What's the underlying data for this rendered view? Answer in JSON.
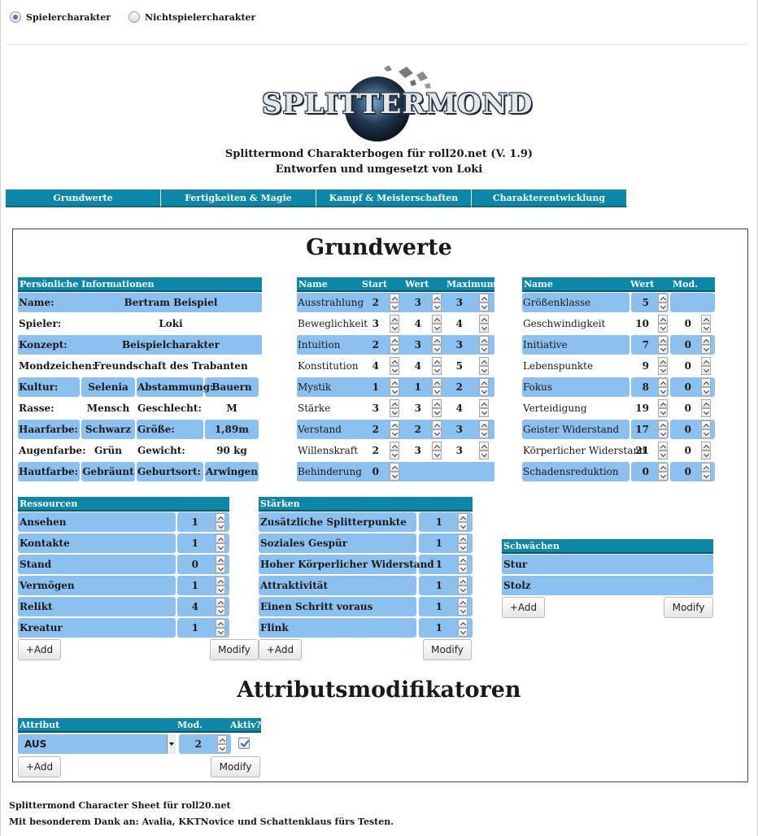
{
  "radio": {
    "pc": "Spielercharakter",
    "npc": "Nichtspielercharakter"
  },
  "logo": {
    "text": "SPLITTERMOND"
  },
  "subtitle": {
    "line1": "Splittermond Charakterbogen für roll20.net (V. 1.9)",
    "line2": "Entworfen und umgesetzt von Loki"
  },
  "tabs": [
    "Grundwerte",
    "Fertigkeiten & Magie",
    "Kampf & Meisterschaften",
    "Charakterentwicklung"
  ],
  "title": "Grundwerte",
  "personal": {
    "header": "Persönliche Informationen",
    "name_label": "Name:",
    "name": "Bertram Beispiel",
    "player_label": "Spieler:",
    "player": "Loki",
    "concept_label": "Konzept:",
    "concept": "Beispielcharakter",
    "moon_label": "Mondzeichen:",
    "moon": "Freundschaft des Trabanten",
    "culture_label": "Kultur:",
    "culture": "Selenia",
    "descent_label": "Abstammung:",
    "descent": "Bauern",
    "race_label": "Rasse:",
    "race": "Mensch",
    "gender_label": "Geschlecht:",
    "gender": "M",
    "hair_label": "Haarfarbe:",
    "hair": "Schwarz",
    "height_label": "Größe:",
    "height": "1,89m",
    "eyes_label": "Augenfarbe:",
    "eyes": "Grün",
    "weight_label": "Gewicht:",
    "weight": "90 kg",
    "skin_label": "Hautfarbe:",
    "skin": "Gebräunt",
    "birthplace_label": "Geburtsort:",
    "birthplace": "Arwingen"
  },
  "attributes": {
    "headers": {
      "name": "Name",
      "start": "Start",
      "value": "Wert",
      "max": "Maximum"
    },
    "rows": [
      {
        "name": "Ausstrahlung",
        "start": "2",
        "value": "3",
        "max": "3"
      },
      {
        "name": "Beweglichkeit",
        "start": "3",
        "value": "4",
        "max": "4"
      },
      {
        "name": "Intuition",
        "start": "2",
        "value": "3",
        "max": "3"
      },
      {
        "name": "Konstitution",
        "start": "4",
        "value": "4",
        "max": "5"
      },
      {
        "name": "Mystik",
        "start": "1",
        "value": "1",
        "max": "2"
      },
      {
        "name": "Stärke",
        "start": "3",
        "value": "3",
        "max": "4"
      },
      {
        "name": "Verstand",
        "start": "2",
        "value": "2",
        "max": "3"
      },
      {
        "name": "Willenskraft",
        "start": "2",
        "value": "3",
        "max": "3"
      }
    ],
    "burden_label": "Behinderung",
    "burden": "0"
  },
  "derived": {
    "headers": {
      "name": "Name",
      "value": "Wert",
      "mod": "Mod."
    },
    "rows": [
      {
        "name": "Größenklasse",
        "value": "5",
        "mod": ""
      },
      {
        "name": "Geschwindigkeit",
        "value": "10",
        "mod": "0"
      },
      {
        "name": "Initiative",
        "value": "7",
        "mod": "0"
      },
      {
        "name": "Lebenspunkte",
        "value": "9",
        "mod": "0"
      },
      {
        "name": "Fokus",
        "value": "8",
        "mod": "0"
      },
      {
        "name": "Verteidigung",
        "value": "19",
        "mod": "0"
      },
      {
        "name": "Geister Widerstand",
        "value": "17",
        "mod": "0"
      },
      {
        "name": "Körperlicher Widerstand",
        "value": "21",
        "mod": "0"
      },
      {
        "name": "Schadensreduktion",
        "value": "0",
        "mod": "0"
      }
    ]
  },
  "resources": {
    "header": "Ressourcen",
    "rows": [
      {
        "name": "Ansehen",
        "value": "1"
      },
      {
        "name": "Kontakte",
        "value": "1"
      },
      {
        "name": "Stand",
        "value": "0"
      },
      {
        "name": "Vermögen",
        "value": "1"
      },
      {
        "name": "Relikt",
        "value": "4"
      },
      {
        "name": "Kreatur",
        "value": "1"
      }
    ]
  },
  "strengths": {
    "header": "Stärken",
    "rows": [
      {
        "name": "Zusätzliche Splitterpunkte",
        "value": "1"
      },
      {
        "name": "Soziales Gespür",
        "value": "1"
      },
      {
        "name": "Hoher Körperlicher Widerstand",
        "value": "1"
      },
      {
        "name": "Attraktivität",
        "value": "1"
      },
      {
        "name": "Einen Schritt voraus",
        "value": "1"
      },
      {
        "name": "Flink",
        "value": "1"
      }
    ]
  },
  "weaknesses": {
    "header": "Schwächen",
    "rows": [
      "Stur",
      "Stolz"
    ]
  },
  "buttons": {
    "add": "+Add",
    "modify": "Modify"
  },
  "attrmod": {
    "title": "Attributsmodifikatoren",
    "headers": {
      "attr": "Attribut",
      "mod": "Mod.",
      "active": "Aktiv?"
    },
    "attribute": "AUS",
    "mod": "2",
    "active": true
  },
  "footer": {
    "line1": "Splittermond Character Sheet für roll20.net",
    "line2": "Mit besonderem Dank an: Avalia, KKTNovice und Schattenklaus fürs Testen."
  },
  "colors": {
    "header": "#0d87a8",
    "field": "#8cc1ef"
  }
}
